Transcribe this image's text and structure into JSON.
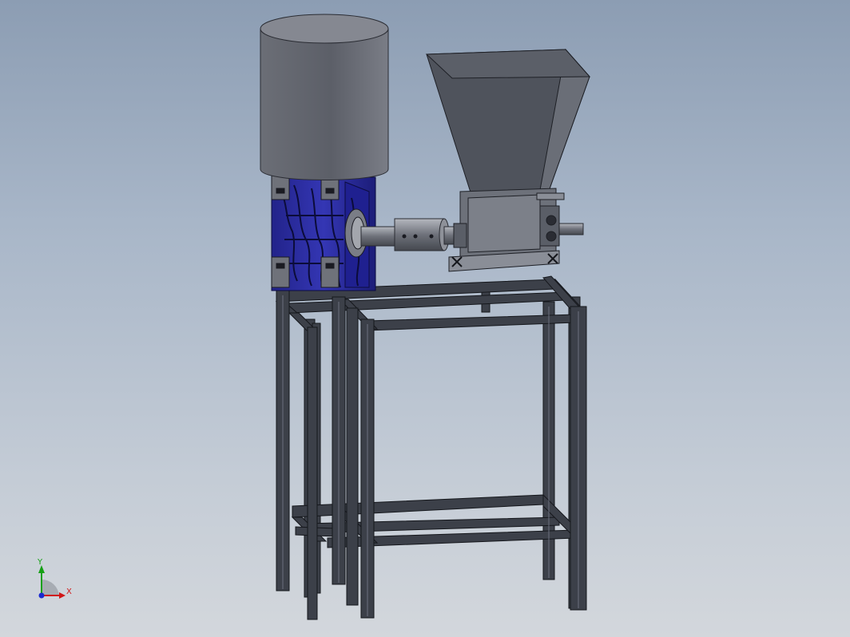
{
  "viewport": {
    "background_top": "#8c9db3",
    "background_bottom": "#d3d7dc"
  },
  "model": {
    "steel_color": "#3c4049",
    "steel_edge_color": "#15171c",
    "cylinder_color": "#6e717a",
    "hopper_color": "#52565f",
    "motor_color": "#2f31a8"
  },
  "triad": {
    "x_label": "X",
    "y_label": "Y",
    "x_color": "#d01818",
    "y_color": "#16a016",
    "z_color": "#1a2ad0"
  }
}
